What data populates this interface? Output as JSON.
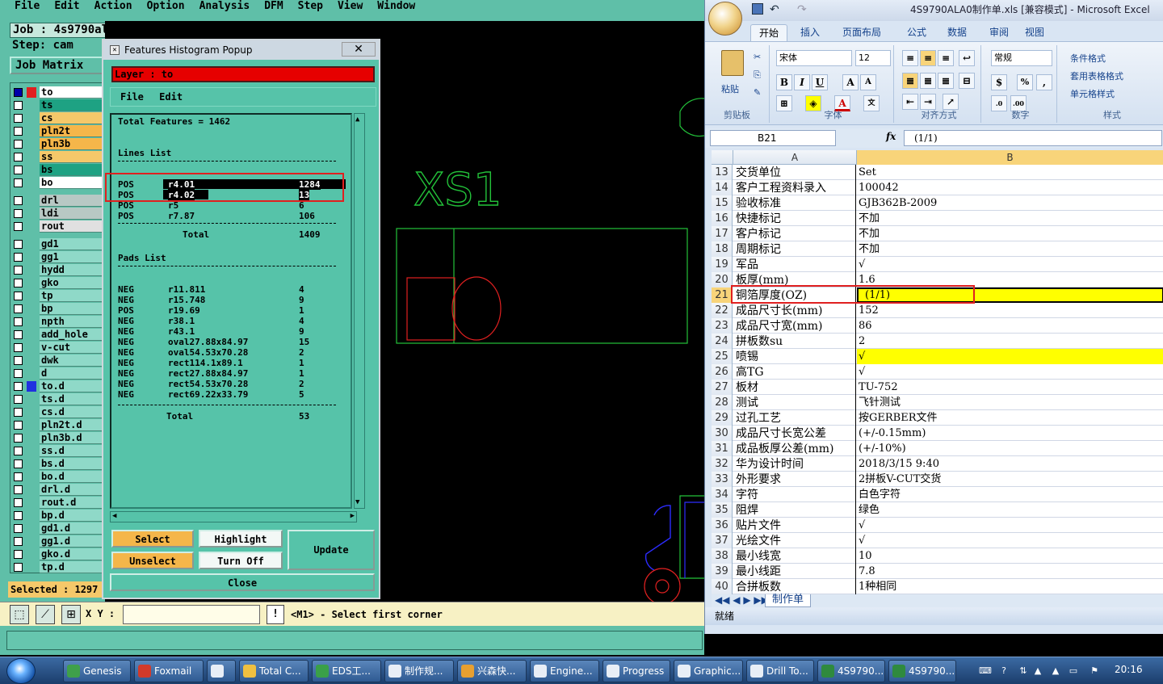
{
  "genesis": {
    "menu": [
      "File",
      "Edit",
      "Action",
      "Option",
      "Analysis",
      "DFM",
      "Step",
      "View",
      "Window"
    ],
    "job_label": "Job : 4s9790ala0",
    "step_label": "Step: cam",
    "job_matrix_button": "Job Matrix",
    "selected_label": "Selected : 1297",
    "layers": [
      {
        "name": "to",
        "color": "#ffffff",
        "checked": true
      },
      {
        "name": "ts",
        "color": "#1ea283",
        "checked": false
      },
      {
        "name": "cs",
        "color": "#f5c86a",
        "checked": false
      },
      {
        "name": "pln2t",
        "color": "#f5b64a",
        "checked": false
      },
      {
        "name": "pln3b",
        "color": "#f5b64a",
        "checked": false
      },
      {
        "name": "ss",
        "color": "#f5c86a",
        "checked": false
      },
      {
        "name": "bs",
        "color": "#1ea283",
        "checked": false
      },
      {
        "name": "bo",
        "color": "#ffffff",
        "checked": false
      },
      {
        "name": "drl",
        "color": "#b8c8c4",
        "checked": false
      },
      {
        "name": "ldi",
        "color": "#b8c8c4",
        "checked": false
      },
      {
        "name": "rout",
        "color": "#e0e0e0",
        "checked": false
      },
      {
        "name": "gd1",
        "color": "#8fd9c8",
        "checked": false
      },
      {
        "name": "gg1",
        "color": "#8fd9c8",
        "checked": false
      },
      {
        "name": "hydd",
        "color": "#8fd9c8",
        "checked": false
      },
      {
        "name": "gko",
        "color": "#8fd9c8",
        "checked": false
      },
      {
        "name": "tp",
        "color": "#8fd9c8",
        "checked": false
      },
      {
        "name": "bp",
        "color": "#8fd9c8",
        "checked": false
      },
      {
        "name": "npth",
        "color": "#8fd9c8",
        "checked": false
      },
      {
        "name": "add_hole",
        "color": "#8fd9c8",
        "checked": false
      },
      {
        "name": "v-cut",
        "color": "#8fd9c8",
        "checked": false
      },
      {
        "name": "dwk",
        "color": "#8fd9c8",
        "checked": false
      },
      {
        "name": "d",
        "color": "#8fd9c8",
        "checked": false
      },
      {
        "name": "to.d",
        "color": "#8fd9c8",
        "checked": false
      },
      {
        "name": "ts.d",
        "color": "#8fd9c8",
        "checked": false
      },
      {
        "name": "cs.d",
        "color": "#8fd9c8",
        "checked": false
      },
      {
        "name": "pln2t.d",
        "color": "#8fd9c8",
        "checked": false
      },
      {
        "name": "pln3b.d",
        "color": "#8fd9c8",
        "checked": false
      },
      {
        "name": "ss.d",
        "color": "#8fd9c8",
        "checked": false
      },
      {
        "name": "bs.d",
        "color": "#8fd9c8",
        "checked": false
      },
      {
        "name": "bo.d",
        "color": "#8fd9c8",
        "checked": false
      },
      {
        "name": "drl.d",
        "color": "#8fd9c8",
        "checked": false
      },
      {
        "name": "rout.d",
        "color": "#8fd9c8",
        "checked": false
      },
      {
        "name": "bp.d",
        "color": "#8fd9c8",
        "checked": false
      },
      {
        "name": "gd1.d",
        "color": "#8fd9c8",
        "checked": false
      },
      {
        "name": "gg1.d",
        "color": "#8fd9c8",
        "checked": false
      },
      {
        "name": "gko.d",
        "color": "#8fd9c8",
        "checked": false
      },
      {
        "name": "tp.d",
        "color": "#8fd9c8",
        "checked": false
      }
    ],
    "canvas_text": "XS1",
    "xy_label": "X Y :",
    "xy_value": "",
    "excl_label": "!",
    "status_message": "<M1> - Select first corner"
  },
  "popup": {
    "title": "Features Histogram Popup",
    "close": "✕",
    "layer_banner": "Layer :  to",
    "menu": [
      "File",
      "Edit"
    ],
    "total_features": "Total Features = 1462",
    "lines_header": "Lines List",
    "lines": [
      {
        "pol": "POS",
        "sym": "r4.01",
        "count": "1284",
        "selected": true
      },
      {
        "pol": "POS",
        "sym": "r4.02",
        "count": "13",
        "selected": true
      },
      {
        "pol": "POS",
        "sym": "r5",
        "count": "6",
        "selected": false
      },
      {
        "pol": "POS",
        "sym": "r7.87",
        "count": "106",
        "selected": false
      }
    ],
    "lines_total_label": "Total",
    "lines_total": "1409",
    "pads_header": "Pads List",
    "pads": [
      {
        "pol": "NEG",
        "sym": "r11.811",
        "count": "4"
      },
      {
        "pol": "NEG",
        "sym": "r15.748",
        "count": "9"
      },
      {
        "pol": "POS",
        "sym": "r19.69",
        "count": "1"
      },
      {
        "pol": "NEG",
        "sym": "r38.1",
        "count": "4"
      },
      {
        "pol": "NEG",
        "sym": "r43.1",
        "count": "9"
      },
      {
        "pol": "NEG",
        "sym": "oval27.88x84.97",
        "count": "15"
      },
      {
        "pol": "NEG",
        "sym": "oval54.53x70.28",
        "count": "2"
      },
      {
        "pol": "NEG",
        "sym": "rect114.1x89.1",
        "count": "1"
      },
      {
        "pol": "NEG",
        "sym": "rect27.88x84.97",
        "count": "1"
      },
      {
        "pol": "NEG",
        "sym": "rect54.53x70.28",
        "count": "2"
      },
      {
        "pol": "NEG",
        "sym": "rect69.22x33.79",
        "count": "5"
      }
    ],
    "pads_total_label": "Total",
    "pads_total": "53",
    "buttons": {
      "select": "Select",
      "highlight": "Highlight",
      "update": "Update",
      "unselect": "Unselect",
      "turn_off": "Turn Off",
      "close": "Close"
    }
  },
  "excel": {
    "title": "4S9790ALA0制作单.xls [兼容模式] - Microsoft Excel",
    "tabs": [
      "开始",
      "插入",
      "页面布局",
      "公式",
      "数据",
      "审阅",
      "视图"
    ],
    "ribbon": {
      "paste": "粘贴",
      "clipboard": "剪贴板",
      "font_name": "宋体",
      "font_size": "12",
      "font_group": "字体",
      "align_group": "对齐方式",
      "number_format": "常规",
      "number_group": "数字",
      "cond_format": "条件格式",
      "table_format": "套用表格格式",
      "cell_style": "单元格样式",
      "style_group": "样式"
    },
    "name_box": "B21",
    "fx": "fx",
    "formula_value": "(1/1)",
    "col_a": "A",
    "col_b": "B",
    "rows": [
      {
        "n": "13",
        "a": "交货单位",
        "b": "Set"
      },
      {
        "n": "14",
        "a": "客户工程资料录入",
        "b": "100042"
      },
      {
        "n": "15",
        "a": "验收标准",
        "b": "GJB362B-2009"
      },
      {
        "n": "16",
        "a": "快捷标记",
        "b": "不加"
      },
      {
        "n": "17",
        "a": "客户标记",
        "b": "不加"
      },
      {
        "n": "18",
        "a": "周期标记",
        "b": "不加"
      },
      {
        "n": "19",
        "a": "军品",
        "b": "√"
      },
      {
        "n": "20",
        "a": "板厚(mm)",
        "b": "1.6"
      },
      {
        "n": "21",
        "a": "铜箔厚度(OZ)",
        "b": "(1/1)",
        "yellow": true,
        "active": true
      },
      {
        "n": "22",
        "a": "成品尺寸长(mm)",
        "b": "152"
      },
      {
        "n": "23",
        "a": "成品尺寸宽(mm)",
        "b": "86"
      },
      {
        "n": "24",
        "a": "拼板数su",
        "b": "2"
      },
      {
        "n": "25",
        "a": "喷锡",
        "b": "√",
        "yellow": true
      },
      {
        "n": "26",
        "a": "高TG",
        "b": "√"
      },
      {
        "n": "27",
        "a": "板材",
        "b": "TU-752"
      },
      {
        "n": "28",
        "a": "测试",
        "b": "飞针测试"
      },
      {
        "n": "29",
        "a": "过孔工艺",
        "b": "按GERBER文件"
      },
      {
        "n": "30",
        "a": "成品尺寸长宽公差",
        "b": "(+/-0.15mm)"
      },
      {
        "n": "31",
        "a": "成品板厚公差(mm)",
        "b": "(+/-10%)"
      },
      {
        "n": "32",
        "a": "华为设计时间",
        "b": "2018/3/15 9:40"
      },
      {
        "n": "33",
        "a": "外形要求",
        "b": "2拼板V-CUT交货"
      },
      {
        "n": "34",
        "a": "字符",
        "b": "白色字符"
      },
      {
        "n": "35",
        "a": "阻焊",
        "b": "绿色"
      },
      {
        "n": "36",
        "a": "贴片文件",
        "b": "√"
      },
      {
        "n": "37",
        "a": "光绘文件",
        "b": "√"
      },
      {
        "n": "38",
        "a": "最小线宽",
        "b": "10"
      },
      {
        "n": "39",
        "a": "最小线距",
        "b": "7.8"
      },
      {
        "n": "40",
        "a": "合拼板数",
        "b": "1种相同"
      }
    ],
    "sheet_tab": "制作单",
    "status": "就绪"
  },
  "taskbar": {
    "items": [
      {
        "label": "Genesis",
        "color": "#3fa04a"
      },
      {
        "label": "Foxmail",
        "color": "#d23a2a"
      },
      {
        "label": "",
        "color": "#e8eef6"
      },
      {
        "label": "Total C...",
        "color": "#f0c040"
      },
      {
        "label": "EDS工...",
        "color": "#3aa048"
      },
      {
        "label": "制作规...",
        "color": "#e8eef6"
      },
      {
        "label": "兴森快...",
        "color": "#e8a030"
      },
      {
        "label": "Engine...",
        "color": "#e8eef6"
      },
      {
        "label": "Progress",
        "color": "#e8eef6"
      },
      {
        "label": "Graphic...",
        "color": "#e8eef6"
      },
      {
        "label": "Drill To...",
        "color": "#e8eef6"
      },
      {
        "label": "4S9790...",
        "color": "#2f8a3e"
      },
      {
        "label": "4S9790...",
        "color": "#2f8a3e"
      }
    ],
    "clock": "20:16"
  }
}
